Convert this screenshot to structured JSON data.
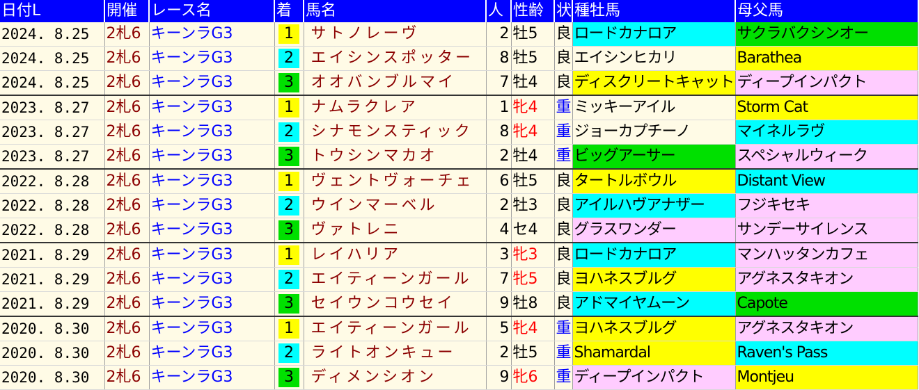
{
  "headers": [
    "日付L",
    "開催",
    "レース名",
    "着",
    "馬名",
    "人",
    "性齢",
    "状",
    "種牡馬",
    "母父馬"
  ],
  "colors": {
    "header_bg": "#0000ff",
    "yellow": "#ffff00",
    "cyan": "#00ffff",
    "green": "#00e000",
    "pink": "#ffccff"
  },
  "rows": [
    {
      "date": "2024. 8.25",
      "venue": "2札6",
      "race": "キーンラG3",
      "rank": "1",
      "horse": "サトノレーヴ",
      "pop": "2",
      "sexage": "牡5",
      "female": false,
      "track": "良",
      "heavy": false,
      "sire": "ロードカナロア",
      "sire_bg": "#00ffff",
      "bms": "サクラバクシンオー",
      "bms_bg": "#00e000",
      "sep": false
    },
    {
      "date": "2024. 8.25",
      "venue": "2札6",
      "race": "キーンラG3",
      "rank": "2",
      "horse": "エイシンスポッター",
      "pop": "8",
      "sexage": "牡5",
      "female": false,
      "track": "良",
      "heavy": false,
      "sire": "エイシンヒカリ",
      "sire_bg": "#fffbe6",
      "bms": "Barathea",
      "bms_bg": "#ffff00",
      "sep": false
    },
    {
      "date": "2024. 8.25",
      "venue": "2札6",
      "race": "キーンラG3",
      "rank": "3",
      "horse": "オオバンブルマイ",
      "pop": "7",
      "sexage": "牡4",
      "female": false,
      "track": "良",
      "heavy": false,
      "sire": "ディスクリートキャット",
      "sire_bg": "#ffff00",
      "bms": "ディープインパクト",
      "bms_bg": "#ffccff",
      "sep": true
    },
    {
      "date": "2023. 8.27",
      "venue": "2札6",
      "race": "キーンラG3",
      "rank": "1",
      "horse": "ナムラクレア",
      "pop": "1",
      "sexage": "牝4",
      "female": true,
      "track": "重",
      "heavy": true,
      "sire": "ミッキーアイル",
      "sire_bg": "#fffbe6",
      "bms": "Storm Cat",
      "bms_bg": "#ffff00",
      "sep": false
    },
    {
      "date": "2023. 8.27",
      "venue": "2札6",
      "race": "キーンラG3",
      "rank": "2",
      "horse": "シナモンスティック",
      "pop": "8",
      "sexage": "牝4",
      "female": true,
      "track": "重",
      "heavy": true,
      "sire": "ジョーカプチーノ",
      "sire_bg": "#fffbe6",
      "bms": "マイネルラヴ",
      "bms_bg": "#00ffff",
      "sep": false
    },
    {
      "date": "2023. 8.27",
      "venue": "2札6",
      "race": "キーンラG3",
      "rank": "3",
      "horse": "トウシンマカオ",
      "pop": "2",
      "sexage": "牡4",
      "female": false,
      "track": "重",
      "heavy": true,
      "sire": "ビッグアーサー",
      "sire_bg": "#00e000",
      "bms": "スペシャルウィーク",
      "bms_bg": "#ffccff",
      "sep": true
    },
    {
      "date": "2022. 8.28",
      "venue": "2札6",
      "race": "キーンラG3",
      "rank": "1",
      "horse": "ヴェントヴォーチェ",
      "pop": "6",
      "sexage": "牡5",
      "female": false,
      "track": "良",
      "heavy": false,
      "sire": "タートルボウル",
      "sire_bg": "#ffff00",
      "bms": "Distant View",
      "bms_bg": "#00ffff",
      "sep": false
    },
    {
      "date": "2022. 8.28",
      "venue": "2札6",
      "race": "キーンラG3",
      "rank": "2",
      "horse": "ウインマーベル",
      "pop": "2",
      "sexage": "牡3",
      "female": false,
      "track": "良",
      "heavy": false,
      "sire": "アイルハヴアナザー",
      "sire_bg": "#00ffff",
      "bms": "フジキセキ",
      "bms_bg": "#ffccff",
      "sep": false
    },
    {
      "date": "2022. 8.28",
      "venue": "2札6",
      "race": "キーンラG3",
      "rank": "3",
      "horse": "ヴァトレニ",
      "pop": "4",
      "sexage": "セ4",
      "female": false,
      "track": "良",
      "heavy": false,
      "sire": "グラスワンダー",
      "sire_bg": "#ffccff",
      "bms": "サンデーサイレンス",
      "bms_bg": "#ffccff",
      "sep": true
    },
    {
      "date": "2021. 8.29",
      "venue": "2札6",
      "race": "キーンラG3",
      "rank": "1",
      "horse": "レイハリア",
      "pop": "3",
      "sexage": "牝3",
      "female": true,
      "track": "良",
      "heavy": false,
      "sire": "ロードカナロア",
      "sire_bg": "#00ffff",
      "bms": "マンハッタンカフェ",
      "bms_bg": "#ffccff",
      "sep": false
    },
    {
      "date": "2021. 8.29",
      "venue": "2札6",
      "race": "キーンラG3",
      "rank": "2",
      "horse": "エイティーンガール",
      "pop": "7",
      "sexage": "牝5",
      "female": true,
      "track": "良",
      "heavy": false,
      "sire": "ヨハネスブルグ",
      "sire_bg": "#ffff00",
      "bms": "アグネスタキオン",
      "bms_bg": "#ffccff",
      "sep": false
    },
    {
      "date": "2021. 8.29",
      "venue": "2札6",
      "race": "キーンラG3",
      "rank": "3",
      "horse": "セイウンコウセイ",
      "pop": "9",
      "sexage": "牡8",
      "female": false,
      "track": "良",
      "heavy": false,
      "sire": "アドマイヤムーン",
      "sire_bg": "#00ffff",
      "bms": "Capote",
      "bms_bg": "#00e000",
      "sep": true
    },
    {
      "date": "2020. 8.30",
      "venue": "2札6",
      "race": "キーンラG3",
      "rank": "1",
      "horse": "エイティーンガール",
      "pop": "5",
      "sexage": "牝4",
      "female": true,
      "track": "重",
      "heavy": true,
      "sire": "ヨハネスブルグ",
      "sire_bg": "#ffff00",
      "bms": "アグネスタキオン",
      "bms_bg": "#ffccff",
      "sep": false
    },
    {
      "date": "2020. 8.30",
      "venue": "2札6",
      "race": "キーンラG3",
      "rank": "2",
      "horse": "ライトオンキュー",
      "pop": "2",
      "sexage": "牡5",
      "female": false,
      "track": "重",
      "heavy": true,
      "sire": "Shamardal",
      "sire_bg": "#ffff00",
      "bms": "Raven's Pass",
      "bms_bg": "#00ffff",
      "sep": false
    },
    {
      "date": "2020. 8.30",
      "venue": "2札6",
      "race": "キーンラG3",
      "rank": "3",
      "horse": "ディメンシオン",
      "pop": "9",
      "sexage": "牝6",
      "female": true,
      "track": "重",
      "heavy": true,
      "sire": "ディープインパクト",
      "sire_bg": "#ffccff",
      "bms": "Montjeu",
      "bms_bg": "#ffff00",
      "sep": false
    }
  ]
}
